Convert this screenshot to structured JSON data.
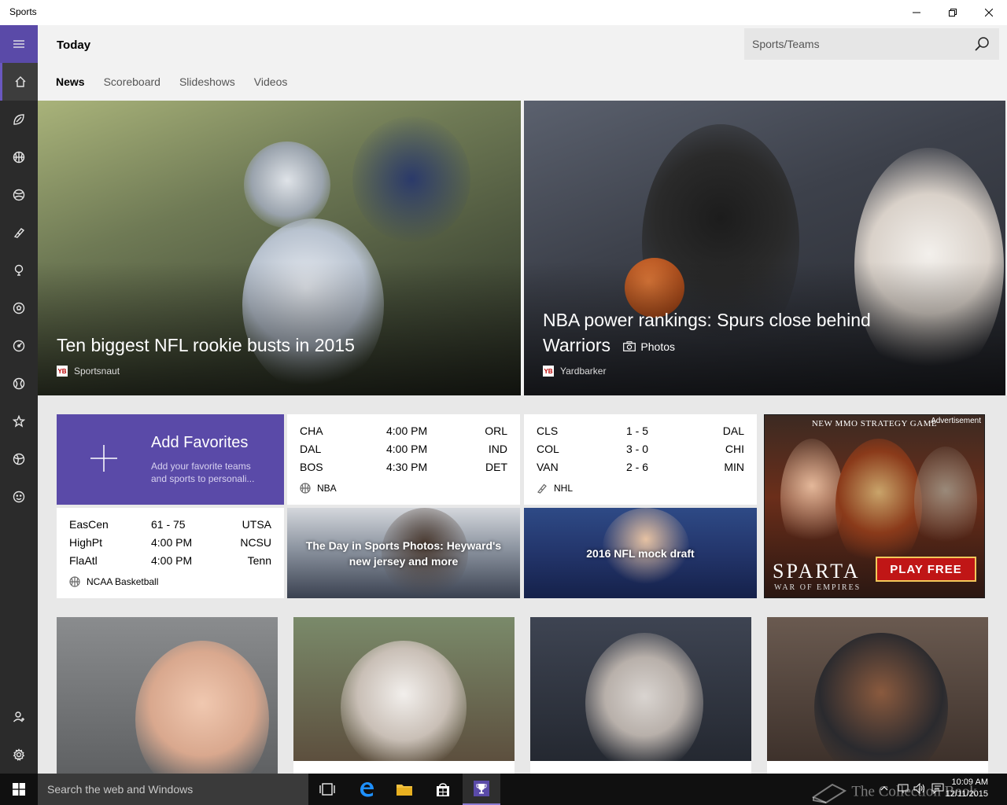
{
  "window": {
    "title": "Sports"
  },
  "header": {
    "page_title": "Today",
    "search_placeholder": "Sports/Teams",
    "tabs": [
      {
        "label": "News",
        "active": true
      },
      {
        "label": "Scoreboard",
        "active": false
      },
      {
        "label": "Slideshows",
        "active": false
      },
      {
        "label": "Videos",
        "active": false
      }
    ]
  },
  "rail": {
    "items": [
      "menu-icon",
      "home-icon",
      "football-icon",
      "basketball-icon",
      "baseball-icon",
      "hockey-icon",
      "golf-icon",
      "soccer-icon",
      "racing-icon",
      "tennis-icon",
      "favorites-icon",
      "more-sports-icon",
      "fantasy-icon"
    ],
    "bottom": [
      "account-icon",
      "settings-icon"
    ]
  },
  "hero": [
    {
      "headline": "Ten biggest NFL rookie busts in 2015",
      "source": "Sportsnaut",
      "source_logo": "YB"
    },
    {
      "headline": "NBA power rankings: Spurs close behind Warriors",
      "tag": "Photos",
      "source": "Yardbarker",
      "source_logo": "YB"
    }
  ],
  "favorites": {
    "title": "Add Favorites",
    "subtitle": "Add your favorite teams and sports to personali..."
  },
  "scores": {
    "nba": {
      "league": "NBA",
      "rows": [
        {
          "home": "CHA",
          "mid": "4:00 PM",
          "away": "ORL"
        },
        {
          "home": "DAL",
          "mid": "4:00 PM",
          "away": "IND"
        },
        {
          "home": "BOS",
          "mid": "4:30 PM",
          "away": "DET"
        }
      ]
    },
    "nhl": {
      "league": "NHL",
      "rows": [
        {
          "home": "CLS",
          "mid": "1 - 5",
          "away": "DAL"
        },
        {
          "home": "COL",
          "mid": "3 - 0",
          "away": "CHI"
        },
        {
          "home": "VAN",
          "mid": "2 - 6",
          "away": "MIN"
        }
      ]
    },
    "ncaa": {
      "league": "NCAA Basketball",
      "rows": [
        {
          "home": "EasCen",
          "mid": "61 - 75",
          "away": "UTSA"
        },
        {
          "home": "HighPt",
          "mid": "4:00 PM",
          "away": "NCSU"
        },
        {
          "home": "FlaAtl",
          "mid": "4:00 PM",
          "away": "Tenn"
        }
      ]
    }
  },
  "photo_tiles": [
    {
      "caption": "The Day in Sports Photos: Heyward's new jersey and more"
    },
    {
      "caption": "2016 NFL mock draft"
    }
  ],
  "ad": {
    "label": "Advertisement",
    "title": "NEW MMO STRATEGY GAME",
    "brand": "SPARTA",
    "sub": "WAR OF EMPIRES",
    "cta": "PLAY FREE"
  },
  "taskbar": {
    "search_placeholder": "Search the web and Windows",
    "time": "10:09 AM",
    "date": "12/11/2015"
  },
  "watermark": "The Collection Book",
  "colors": {
    "accent": "#5a4aa8",
    "rail": "#2b2b2b",
    "taskbar": "#101010"
  }
}
